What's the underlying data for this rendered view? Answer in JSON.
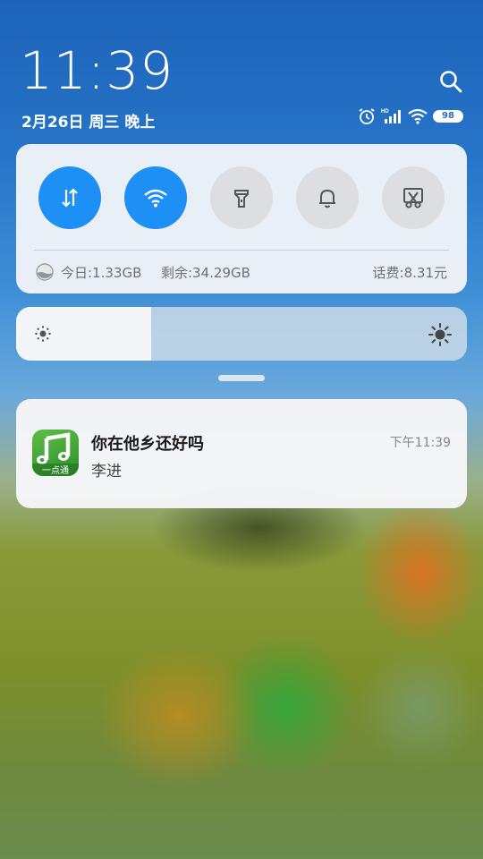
{
  "status": {
    "time": "11:39",
    "date": "2月26日 周三 晚上",
    "battery": "98",
    "icons": [
      "alarm-icon",
      "hd-signal-icon",
      "wifi-icon",
      "battery-icon"
    ]
  },
  "quick_toggles": [
    {
      "name": "mobile-data",
      "icon": "data-arrows-icon",
      "on": true
    },
    {
      "name": "wifi",
      "icon": "wifi-icon",
      "on": true
    },
    {
      "name": "flashlight",
      "icon": "flashlight-icon",
      "on": false
    },
    {
      "name": "sound",
      "icon": "bell-icon",
      "on": false
    },
    {
      "name": "screenshot",
      "icon": "scissors-icon",
      "on": false
    }
  ],
  "data_usage": {
    "today": "今日:1.33GB",
    "remaining": "剩余:34.29GB",
    "balance": "话费:8.31元"
  },
  "brightness": {
    "level": 0.3
  },
  "notification": {
    "app_icon_text": "一点通",
    "title": "你在他乡还好吗",
    "body": "李进",
    "time": "下午11:39"
  },
  "colors": {
    "accent": "#1e90f5",
    "toggle_off": "#dcdee1"
  }
}
